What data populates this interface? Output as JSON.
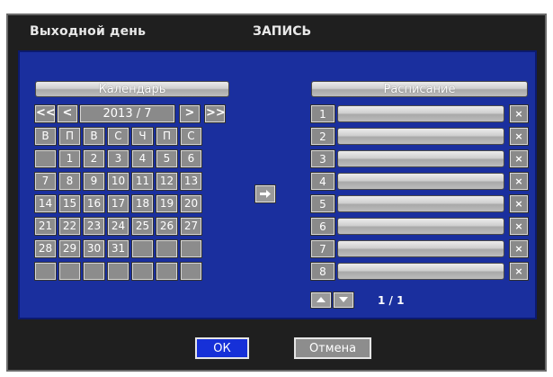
{
  "header": {
    "left_title": "Выходной день",
    "center_title": "ЗАПИСЬ"
  },
  "calendar": {
    "title": "Календарь",
    "prev_year_label": "<<",
    "prev_month_label": "<",
    "next_month_label": ">",
    "next_year_label": ">>",
    "month_label": "2013 / 7",
    "weekdays": [
      "В",
      "П",
      "В",
      "С",
      "Ч",
      "П",
      "С"
    ],
    "days": [
      [
        "",
        "1",
        "2",
        "3",
        "4",
        "5",
        "6"
      ],
      [
        "7",
        "8",
        "9",
        "10",
        "11",
        "12",
        "13"
      ],
      [
        "14",
        "15",
        "16",
        "17",
        "18",
        "19",
        "20"
      ],
      [
        "21",
        "22",
        "23",
        "24",
        "25",
        "26",
        "27"
      ],
      [
        "28",
        "29",
        "30",
        "31",
        "",
        "",
        ""
      ],
      [
        "",
        "",
        "",
        "",
        "",
        "",
        ""
      ]
    ]
  },
  "schedule": {
    "title": "Расписание",
    "rows": [
      "1",
      "2",
      "3",
      "4",
      "5",
      "6",
      "7",
      "8"
    ],
    "delete_label": "×",
    "page_label": "1 / 1"
  },
  "footer": {
    "ok_label": "ОК",
    "cancel_label": "Отмена"
  },
  "colors": {
    "panel": "#1a2f9e",
    "ok_button": "#1630d8",
    "dialog": "#1f1f1f"
  }
}
